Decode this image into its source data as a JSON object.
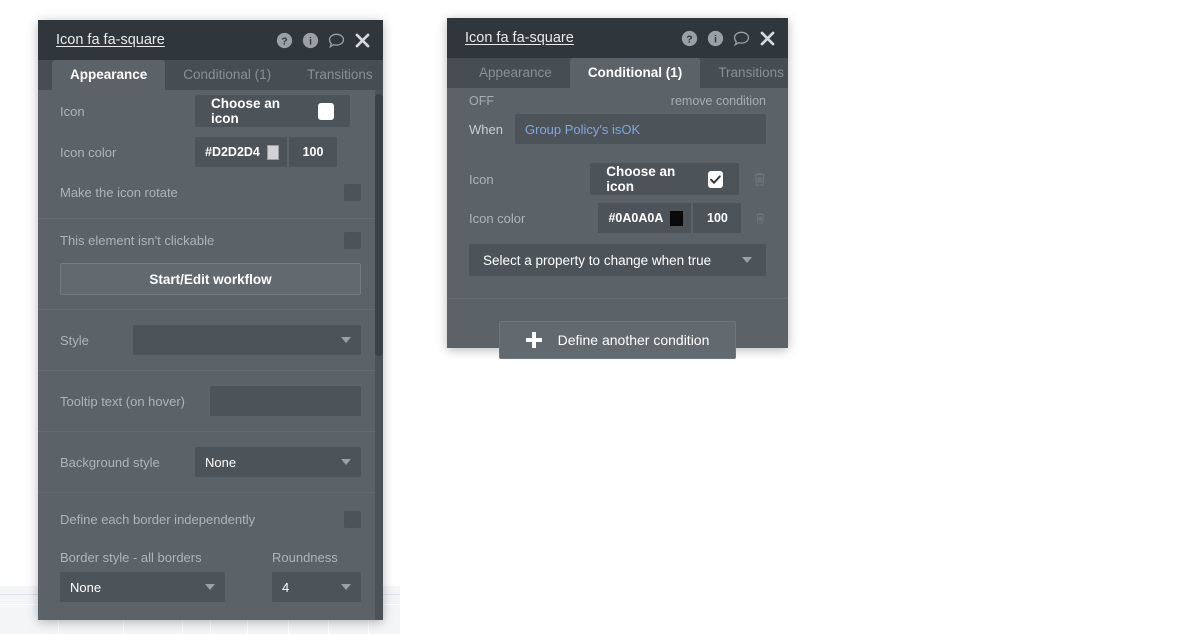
{
  "colors": {
    "panel_body": "#5b6369",
    "panel_header": "#2f363c",
    "tabbar": "#464e54",
    "field": "#4c545a",
    "label_text": "#aeb4b8",
    "link_blue": "#7fa8dd"
  },
  "left_panel": {
    "title": "Icon fa fa-square",
    "header_icons": [
      {
        "name": "help-icon",
        "glyph": "?"
      },
      {
        "name": "info-icon",
        "glyph": "i"
      },
      {
        "name": "comment-icon",
        "glyph": "comment"
      },
      {
        "name": "close-icon",
        "glyph": "x"
      }
    ],
    "tabs": [
      {
        "label": "Appearance",
        "active": true
      },
      {
        "label": "Conditional (1)",
        "active": false
      },
      {
        "label": "Transitions",
        "active": false
      }
    ],
    "rows": {
      "icon_label": "Icon",
      "choose_icon_label": "Choose an icon",
      "icon_color_label": "Icon color",
      "icon_color_hex": "#D2D2D4",
      "icon_color_swatch": "#d2d2d4",
      "icon_color_opacity": "100",
      "rotate_label": "Make the icon rotate",
      "not_clickable_label": "This element isn't clickable",
      "workflow_button": "Start/Edit workflow",
      "style_label": "Style",
      "style_value": "",
      "tooltip_label": "Tooltip text (on hover)",
      "tooltip_value": "",
      "background_style_label": "Background style",
      "background_style_value": "None",
      "define_borders_label": "Define each border independently",
      "border_style_label": "Border style - all borders",
      "border_style_value": "None",
      "roundness_label": "Roundness",
      "roundness_value": "4"
    }
  },
  "right_panel": {
    "title": "Icon fa fa-square",
    "header_icons": [
      {
        "name": "help-icon",
        "glyph": "?"
      },
      {
        "name": "info-icon",
        "glyph": "i"
      },
      {
        "name": "comment-icon",
        "glyph": "comment"
      },
      {
        "name": "close-icon",
        "glyph": "x"
      }
    ],
    "tabs": [
      {
        "label": "Appearance",
        "active": false
      },
      {
        "label": "Conditional (1)",
        "active": true
      },
      {
        "label": "Transitions",
        "active": false
      }
    ],
    "condition": {
      "state_label": "OFF",
      "remove_label": "remove condition",
      "when_label": "When",
      "when_expression": "Group Policy's isOK",
      "icon_label": "Icon",
      "choose_icon_label": "Choose an icon",
      "icon_color_label": "Icon color",
      "icon_color_hex": "#0A0A0A",
      "icon_color_swatch": "#0a0a0a",
      "icon_color_opacity": "100",
      "property_select_placeholder": "Select a property to change when true",
      "define_another_label": "Define another condition"
    }
  }
}
